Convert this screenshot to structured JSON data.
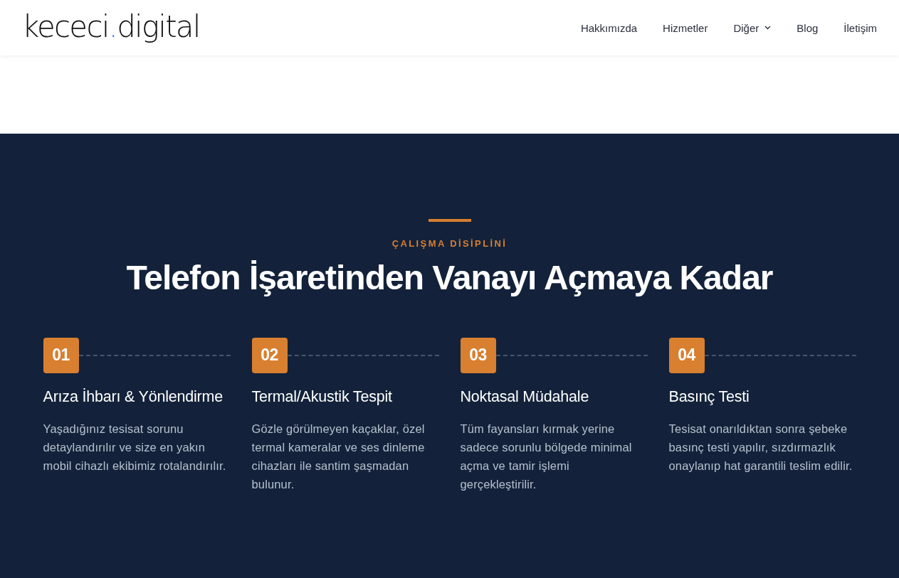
{
  "header": {
    "logo": {
      "name": "kececi",
      "dot": ".",
      "suffix": "digital"
    },
    "nav": [
      {
        "label": "Hakkımızda",
        "kind": "link"
      },
      {
        "label": "Hizmetler",
        "kind": "link"
      },
      {
        "label": "Diğer",
        "kind": "dropdown"
      },
      {
        "label": "Blog",
        "kind": "link"
      },
      {
        "label": "İletişim",
        "kind": "link"
      }
    ]
  },
  "process": {
    "eyebrow": "ÇALIŞMA DİSİPLİNİ",
    "title": "Telefon İşaretinden Vanayı Açmaya Kadar",
    "steps": [
      {
        "number": "01",
        "title": "Arıza İhbarı & Yönlendirme",
        "description": "Yaşadığınız tesisat sorunu detaylandırılır ve size en yakın mobil cihazlı ekibimiz rotalandırılır."
      },
      {
        "number": "02",
        "title": "Termal/Akustik Tespit",
        "description": "Gözle görülmeyen kaçaklar, özel termal kameralar ve ses dinleme cihazları ile santim şaşmadan bulunur."
      },
      {
        "number": "03",
        "title": "Noktasal Müdahale",
        "description": "Tüm fayansları kırmak yerine sadece sorunlu bölgede minimal açma ve tamir işlemi gerçekleştirilir."
      },
      {
        "number": "04",
        "title": "Basınç Testi",
        "description": "Tesisat onarıldıktan sonra şebeke basınç testi yapılır, sızdırmazlık onaylanıp hat garantili teslim edilir."
      }
    ]
  }
}
